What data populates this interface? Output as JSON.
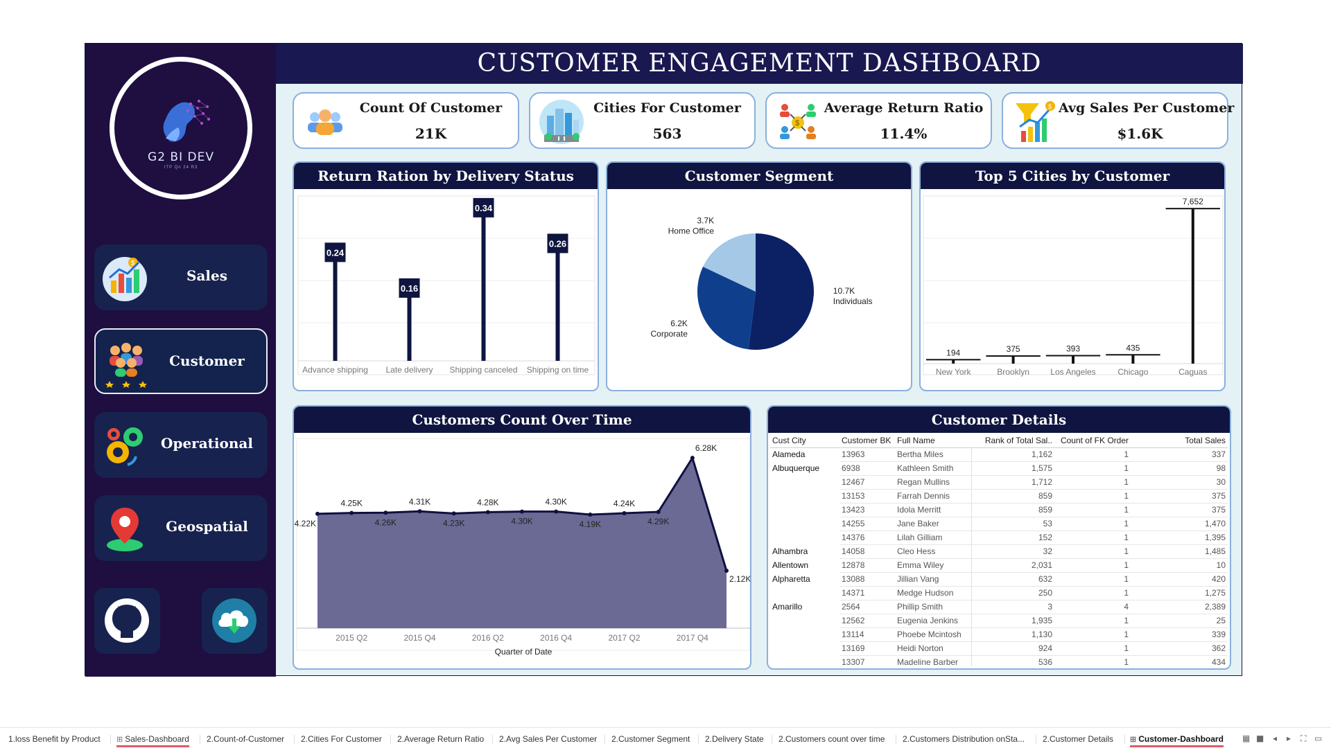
{
  "header": {
    "title": "CUSTOMER ENGAGEMENT DASHBOARD"
  },
  "logo": {
    "text": "G2 BI DEV",
    "subtitle": "ITP Qn 24 R3"
  },
  "sidebar": {
    "items": [
      {
        "label": "Sales",
        "icon": "bar-chart-icon",
        "active": false
      },
      {
        "label": "Customer",
        "icon": "customers-icon",
        "active": true
      },
      {
        "label": "Operational",
        "icon": "gears-icon",
        "active": false
      },
      {
        "label": "Geospatial",
        "icon": "map-pin-icon",
        "active": false
      }
    ],
    "bottom_buttons": [
      {
        "icon": "github-icon"
      },
      {
        "icon": "cloud-download-icon"
      }
    ]
  },
  "kpis": [
    {
      "label": "Count Of Customer",
      "value": "21K",
      "icon": "people-icon"
    },
    {
      "label": "Cities For Customer",
      "value": "563",
      "icon": "city-icon"
    },
    {
      "label": "Average Return Ratio",
      "value": "11.4%",
      "icon": "return-exchange-icon"
    },
    {
      "label": "Avg Sales Per Customer",
      "value": "$1.6K",
      "icon": "funnel-chart-icon"
    }
  ],
  "colors": {
    "navy": "#0f1540",
    "sidebar": "#1e0f40",
    "pie_dark": "#0c2163",
    "pie_mid": "#0f3f8c",
    "pie_light": "#a4c8e6",
    "area_fill": "#6b6a95"
  },
  "panels": {
    "return_ratio": "Return Ration by Delivery Status",
    "segment": "Customer Segment",
    "top_cities": "Top 5 Cities by Customer",
    "count_over_time": "Customers Count Over Time",
    "details": "Customer Details"
  },
  "chart_data": [
    {
      "type": "bar",
      "title": "Return Ration by Delivery Status",
      "categories": [
        "Advance shipping",
        "Late delivery",
        "Shipping canceled",
        "Shipping on time"
      ],
      "values": [
        0.24,
        0.16,
        0.34,
        0.26
      ],
      "labels": [
        "0.24",
        "0.16",
        "0.34",
        "0.26"
      ],
      "ylim": [
        0,
        0.36
      ]
    },
    {
      "type": "pie",
      "title": "Customer Segment",
      "categories": [
        "Individuals",
        "Corporate",
        "Home Office"
      ],
      "values": [
        10.7,
        6.2,
        3.7
      ],
      "labels": [
        "10.7K",
        "6.2K",
        "3.7K"
      ]
    },
    {
      "type": "bar",
      "title": "Top 5 Cities by Customer",
      "categories": [
        "New York",
        "Brooklyn",
        "Los Angeles",
        "Chicago",
        "Caguas"
      ],
      "values": [
        194,
        375,
        393,
        435,
        7652
      ],
      "labels": [
        "194",
        "375",
        "393",
        "435",
        "7,652"
      ],
      "ylim": [
        0,
        8000
      ]
    },
    {
      "type": "area",
      "title": "Customers Count Over Time",
      "xlabel": "Quarter of Date",
      "x": [
        "2015 Q1",
        "2015 Q2",
        "2015 Q3",
        "2015 Q4",
        "2016 Q1",
        "2016 Q2",
        "2016 Q3",
        "2016 Q4",
        "2017 Q1",
        "2017 Q2",
        "2017 Q3",
        "2017 Q4",
        "2018 Q1"
      ],
      "tick_labels": [
        "2015 Q2",
        "2015 Q4",
        "2016 Q2",
        "2016 Q4",
        "2017 Q2",
        "2017 Q4"
      ],
      "values": [
        4.22,
        4.25,
        4.26,
        4.31,
        4.23,
        4.28,
        4.3,
        4.3,
        4.19,
        4.24,
        4.29,
        6.28,
        2.12
      ],
      "labels": [
        "4.22K",
        "4.25K",
        "4.26K",
        "4.31K",
        "4.23K",
        "4.28K",
        "4.30K",
        "4.30K",
        "4.19K",
        "4.24K",
        "4.29K",
        "6.28K",
        "2.12K"
      ],
      "ylim": [
        0,
        7.0
      ]
    }
  ],
  "customer_details": {
    "columns": [
      "Cust City",
      "Customer BK",
      "Full Name",
      "Rank of Total Sal..",
      "Count of FK Order",
      "Total Sales"
    ],
    "rows": [
      [
        "Alameda",
        "13963",
        "Bertha Miles",
        "1,162",
        "1",
        "337"
      ],
      [
        "Albuquerque",
        "6938",
        "Kathleen Smith",
        "1,575",
        "1",
        "98"
      ],
      [
        "",
        "12467",
        "Regan Mullins",
        "1,712",
        "1",
        "30"
      ],
      [
        "",
        "13153",
        "Farrah Dennis",
        "859",
        "1",
        "375"
      ],
      [
        "",
        "13423",
        "Idola Merritt",
        "859",
        "1",
        "375"
      ],
      [
        "",
        "14255",
        "Jane Baker",
        "53",
        "1",
        "1,470"
      ],
      [
        "",
        "14376",
        "Lilah Gilliam",
        "152",
        "1",
        "1,395"
      ],
      [
        "Alhambra",
        "14058",
        "Cleo Hess",
        "32",
        "1",
        "1,485"
      ],
      [
        "Allentown",
        "12878",
        "Emma Wiley",
        "2,031",
        "1",
        "10"
      ],
      [
        "Alpharetta",
        "13088",
        "Jillian Vang",
        "632",
        "1",
        "420"
      ],
      [
        "",
        "14371",
        "Medge Hudson",
        "250",
        "1",
        "1,275"
      ],
      [
        "Amarillo",
        "2564",
        "Phillip Smith",
        "3",
        "4",
        "2,389"
      ],
      [
        "",
        "12562",
        "Eugenia Jenkins",
        "1,935",
        "1",
        "25"
      ],
      [
        "",
        "13114",
        "Phoebe Mcintosh",
        "1,130",
        "1",
        "339"
      ],
      [
        "",
        "13169",
        "Heidi Norton",
        "924",
        "1",
        "362"
      ],
      [
        "",
        "13307",
        "Madeline Barber",
        "536",
        "1",
        "434"
      ]
    ]
  },
  "tabs": [
    {
      "label": "1.loss Benefit by Product",
      "icon": ""
    },
    {
      "label": "Sales-Dashboard",
      "icon": "dashboard-icon"
    },
    {
      "label": "2.Count-of-Customer",
      "icon": ""
    },
    {
      "label": "2.Cities For Customer",
      "icon": ""
    },
    {
      "label": "2.Average Return Ratio",
      "icon": ""
    },
    {
      "label": "2.Avg Sales Per Customer",
      "icon": ""
    },
    {
      "label": "2.Customer Segment",
      "icon": ""
    },
    {
      "label": "2.Delivery State",
      "icon": ""
    },
    {
      "label": "2.Customers count over time",
      "icon": ""
    },
    {
      "label": "2.Customers Distribution onSta...",
      "icon": ""
    },
    {
      "label": "2.Customer Details",
      "icon": ""
    },
    {
      "label": "Customer-Dashboard",
      "icon": "dashboard-icon",
      "active": true
    }
  ]
}
